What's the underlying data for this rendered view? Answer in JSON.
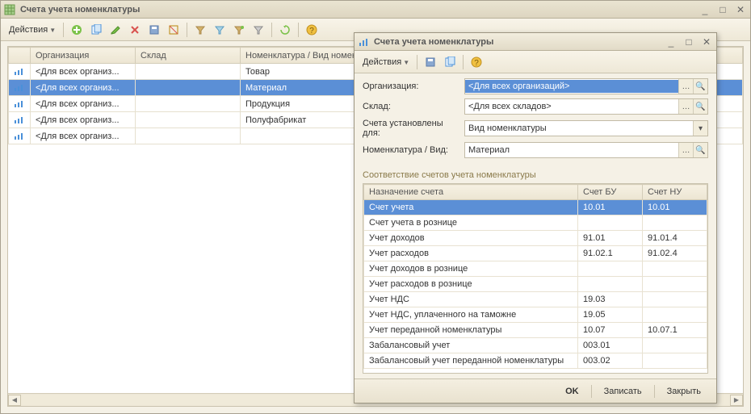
{
  "main": {
    "title": "Счета учета номенклатуры",
    "actions_label": "Действия",
    "columns": [
      "",
      "Организация",
      "Склад",
      "Номенклатура / Вид номенклатуры"
    ],
    "rows": [
      {
        "org": "<Для всех организ...",
        "sklad": "",
        "nom": "Товар"
      },
      {
        "org": "<Для всех организ...",
        "sklad": "",
        "nom": "Материал",
        "selected": true
      },
      {
        "org": "<Для всех организ...",
        "sklad": "",
        "nom": "Продукция"
      },
      {
        "org": "<Для всех организ...",
        "sklad": "",
        "nom": "Полуфабрикат"
      },
      {
        "org": "<Для всех организ...",
        "sklad": "",
        "nom": ""
      }
    ]
  },
  "dialog": {
    "title": "Счета учета номенклатуры",
    "actions_label": "Действия",
    "fields": {
      "org_label": "Организация:",
      "org_value": "<Для всех организаций>",
      "sklad_label": "Склад:",
      "sklad_value": "<Для всех складов>",
      "setfor_label": "Счета установлены для:",
      "setfor_value": "Вид номенклатуры",
      "nomvid_label": "Номенклатура / Вид:",
      "nomvid_value": "Материал"
    },
    "section_title": "Соответствие счетов учета номенклатуры",
    "acct_columns": [
      "Назначение счета",
      "Счет БУ",
      "Счет НУ"
    ],
    "acct_rows": [
      {
        "name": "Счет учета",
        "bu": "10.01",
        "nu": "10.01",
        "selected": true
      },
      {
        "name": "Счет учета в рознице",
        "bu": "",
        "nu": ""
      },
      {
        "name": "Учет доходов",
        "bu": "91.01",
        "nu": "91.01.4"
      },
      {
        "name": "Учет расходов",
        "bu": "91.02.1",
        "nu": "91.02.4"
      },
      {
        "name": "Учет доходов в рознице",
        "bu": "",
        "nu": ""
      },
      {
        "name": "Учет расходов в рознице",
        "bu": "",
        "nu": ""
      },
      {
        "name": "Учет НДС",
        "bu": "19.03",
        "nu": ""
      },
      {
        "name": "Учет НДС, уплаченного на таможне",
        "bu": "19.05",
        "nu": ""
      },
      {
        "name": "Учет переданной номенклатуры",
        "bu": "10.07",
        "nu": "10.07.1"
      },
      {
        "name": "Забалансовый учет",
        "bu": "003.01",
        "nu": ""
      },
      {
        "name": "Забалансовый учет переданной номенклатуры",
        "bu": "003.02",
        "nu": ""
      }
    ],
    "buttons": {
      "ok": "OK",
      "save": "Записать",
      "close": "Закрыть"
    }
  }
}
